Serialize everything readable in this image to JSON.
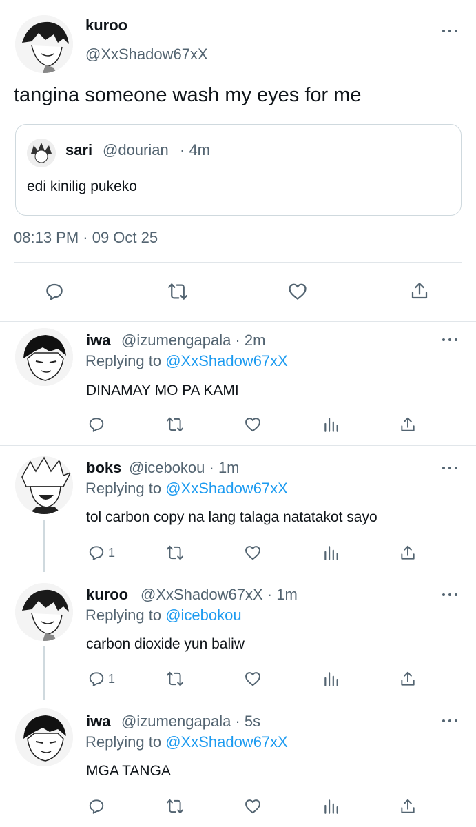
{
  "main_tweet": {
    "author_name": "kuroo",
    "author_handle": "@XxShadow67xX",
    "text": "tangina someone wash my eyes for me",
    "quote": {
      "author_name": "sari",
      "author_handle": "@dourian",
      "time": "· 4m",
      "text": "edi kinilig pukeko"
    },
    "timestamp": "08:13 PM · 09 Oct 25"
  },
  "replies": [
    {
      "author_name": "iwa",
      "author_handle": "@izumengapala · 2m",
      "replying_prefix": "Replying to ",
      "replying_to": "@XxShadow67xX",
      "text": "DINAMAY MO PA KAMI",
      "reply_count": ""
    },
    {
      "author_name": "boks",
      "author_handle": "@icebokou · 1m",
      "replying_prefix": "Replying to ",
      "replying_to": "@XxShadow67xX",
      "text": "tol carbon copy na lang talaga natatakot sayo",
      "reply_count": "1"
    },
    {
      "author_name": "kuroo",
      "author_handle": "@XxShadow67xX · 1m",
      "replying_prefix": "Replying to ",
      "replying_to": "@icebokou",
      "text": "carbon dioxide yun baliw",
      "reply_count": "1"
    },
    {
      "author_name": "iwa",
      "author_handle": "@izumengapala · 5s",
      "replying_prefix": "Replying to ",
      "replying_to": "@XxShadow67xX",
      "text": "MGA TANGA",
      "reply_count": ""
    }
  ],
  "colors": {
    "accent": "#1d9bf0",
    "secondary_text": "#536471",
    "divider": "#e1e6ea"
  },
  "icons": [
    "reply-icon",
    "retweet-icon",
    "like-icon",
    "analytics-icon",
    "share-icon",
    "more-icon"
  ]
}
